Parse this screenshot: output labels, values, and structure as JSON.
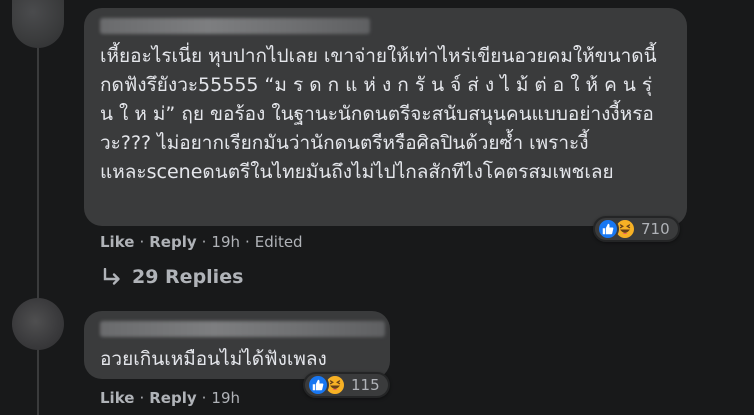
{
  "comments": [
    {
      "body": "เหี้ยอะไรเนี่ย หุบปากไปเลย เขาจ่ายให้เท่าไหร่เขียนอวยคมให้ขนาดนี้ กดฟังรึยังวะ55555 “ม ร ด ก แ ห่ ง ก รั น จ์ ส่ ง ไ ม้ ต่ อ ใ ห้ ค น รุ่ น ใ ห ม่” ฤย ขอร้อง ในฐานะนักดนตรีจะสนับสนุนคนแบบอย่างงี้หรอวะ??? ไม่อยากเรียกมันว่านักดนตรีหรือศิลปินด้วยซ้ำ เพราะงี้แหละsceneดนตรีในไทยมันถึงไม่ไปไกลสักทีไงโคตรสมเพชเลย",
      "reaction_count": "710",
      "reactions": [
        "like-icon",
        "haha-icon"
      ],
      "actions": {
        "like": "Like",
        "reply": "Reply",
        "time": "19h",
        "edited": "Edited"
      }
    },
    {
      "body": "อวยเกินเหมือนไม่ได้ฟังเพลง",
      "reaction_count": "115",
      "reactions": [
        "like-icon",
        "haha-icon"
      ],
      "actions": {
        "like": "Like",
        "reply": "Reply",
        "time": "19h"
      }
    }
  ],
  "replies_link": "29 Replies",
  "separator": "·",
  "colors": {
    "background": "#18191a",
    "bubble": "#3a3b3c",
    "text": "#e4e6eb",
    "muted": "#b0b3b8",
    "like_blue": "#1877f2",
    "haha_yellow": "#f7b125"
  }
}
